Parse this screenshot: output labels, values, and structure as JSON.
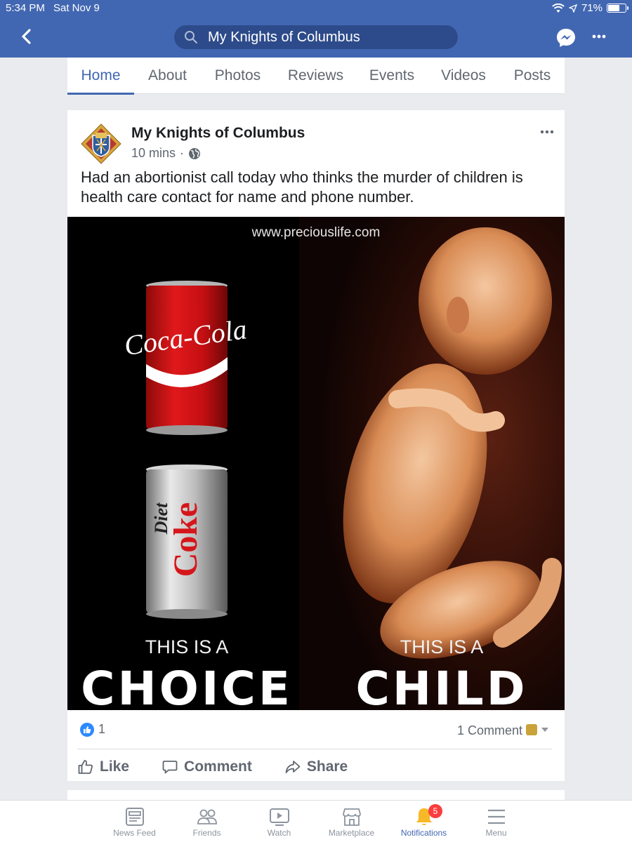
{
  "status": {
    "time": "5:34 PM",
    "date": "Sat Nov 9",
    "battery": "71%",
    "battery_level": 0.71
  },
  "header": {
    "search_text": "My Knights of Columbus"
  },
  "tabs": [
    {
      "label": "Home",
      "active": true
    },
    {
      "label": "About"
    },
    {
      "label": "Photos"
    },
    {
      "label": "Reviews"
    },
    {
      "label": "Events"
    },
    {
      "label": "Videos"
    },
    {
      "label": "Posts"
    }
  ],
  "post": {
    "author": "My Knights of Columbus",
    "time": "10 mins",
    "separator": "·",
    "text": "Had an abortionist call today who thinks the murder of children is health care contact for name and phone number.",
    "image": {
      "url_text": "www.preciouslife.com",
      "left_small": "THIS IS A",
      "left_big": "CHOICE",
      "right_small": "THIS IS A",
      "right_big": "CHILD",
      "can1_text": "Coca-Cola",
      "can2_text_a": "Diet",
      "can2_text_b": "Coke"
    },
    "like_count": "1",
    "comment_count": "1 Comment",
    "actions": {
      "like": "Like",
      "comment": "Comment",
      "share": "Share"
    }
  },
  "bottom_nav": [
    {
      "label": "News Feed",
      "icon": "news-feed-icon"
    },
    {
      "label": "Friends",
      "icon": "friends-icon"
    },
    {
      "label": "Watch",
      "icon": "watch-icon"
    },
    {
      "label": "Marketplace",
      "icon": "marketplace-icon"
    },
    {
      "label": "Notifications",
      "icon": "bell-icon",
      "active": true,
      "badge": "5"
    },
    {
      "label": "Menu",
      "icon": "menu-icon"
    }
  ],
  "colors": {
    "brand": "#4267b2",
    "badge": "#fa3e3e"
  }
}
